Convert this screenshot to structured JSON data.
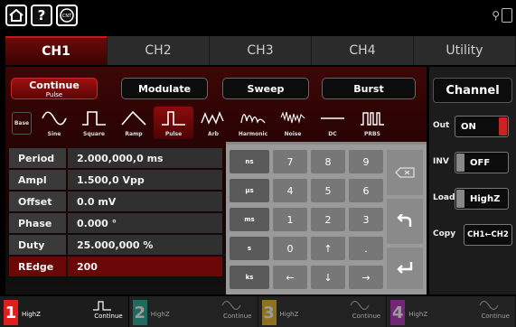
{
  "top": {
    "home_icon": "home-icon",
    "help_icon": "help-icon",
    "cnt_label": "CNT",
    "status_icon": "usb-icon"
  },
  "tabs": [
    {
      "label": "CH1",
      "active": true
    },
    {
      "label": "CH2"
    },
    {
      "label": "CH3"
    },
    {
      "label": "CH4"
    },
    {
      "label": "Utility"
    }
  ],
  "modes": {
    "continue": "Continue",
    "continue_sub": "Pulse",
    "modulate": "Modulate",
    "sweep": "Sweep",
    "burst": "Burst"
  },
  "base_label": "Base",
  "waves": [
    {
      "label": "Sine",
      "icon": "sine-wave-icon"
    },
    {
      "label": "Square",
      "icon": "square-wave-icon"
    },
    {
      "label": "Ramp",
      "icon": "ramp-wave-icon"
    },
    {
      "label": "Pulse",
      "icon": "pulse-wave-icon",
      "active": true
    },
    {
      "label": "Arb",
      "icon": "arb-wave-icon"
    },
    {
      "label": "Harmonic",
      "icon": "harmonic-wave-icon"
    },
    {
      "label": "Noise",
      "icon": "noise-wave-icon"
    },
    {
      "label": "DC",
      "icon": "dc-wave-icon"
    },
    {
      "label": "PRBS",
      "icon": "prbs-wave-icon"
    }
  ],
  "params": [
    {
      "label": "Period",
      "value": "2.000,000,0 ms"
    },
    {
      "label": "Ampl",
      "value": "1.500,0 Vpp"
    },
    {
      "label": "Offset",
      "value": "0.0 mV"
    },
    {
      "label": "Phase",
      "value": "0.000 °"
    },
    {
      "label": "Duty",
      "value": "25.000,000 %"
    },
    {
      "label": "REdge",
      "value": "200",
      "selected": true
    }
  ],
  "keypad": {
    "units": [
      "ns",
      "µs",
      "ms",
      "s",
      "ks"
    ],
    "digits": [
      "7",
      "8",
      "9",
      "4",
      "5",
      "6",
      "1",
      "2",
      "3",
      "0",
      "↑",
      "."
    ],
    "arrows": [
      "←",
      "↓",
      "→"
    ]
  },
  "channel": {
    "title": "Channel",
    "out_label": "Out",
    "out_value": "ON",
    "inv_label": "INV",
    "inv_value": "OFF",
    "load_label": "Load",
    "load_value": "HighZ",
    "copy_label": "Copy",
    "copy_value": "CH1←CH2"
  },
  "bottom": [
    {
      "num": "1",
      "load": "HighZ",
      "mode": "Continue",
      "color": "#e01e1e"
    },
    {
      "num": "2",
      "load": "HighZ",
      "mode": "Continue",
      "color": "#1aa88e"
    },
    {
      "num": "3",
      "load": "HighZ",
      "mode": "Continue",
      "color": "#e3b21c"
    },
    {
      "num": "4",
      "load": "HighZ",
      "mode": "Continue",
      "color": "#b42bbb"
    }
  ],
  "colors": {
    "accent": "#a01010",
    "key_gray": "#777777"
  }
}
